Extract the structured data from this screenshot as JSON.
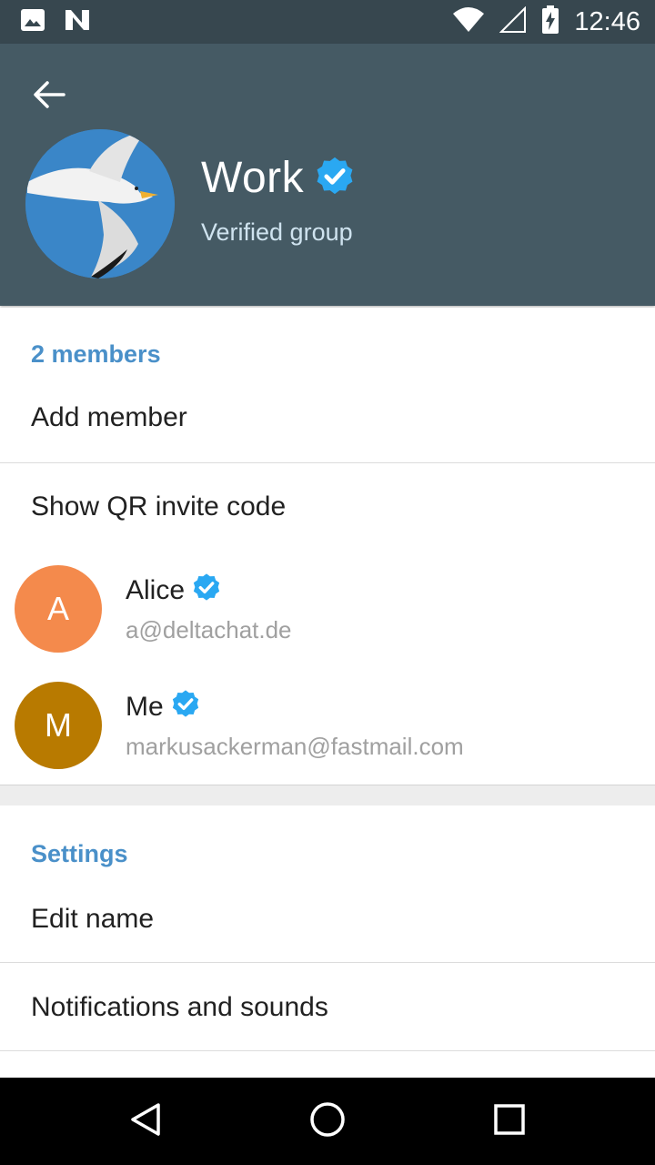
{
  "status_bar": {
    "time": "12:46",
    "icons": [
      "image-icon",
      "n-notification-icon",
      "wifi-icon",
      "cell-signal-icon",
      "battery-charging-icon"
    ]
  },
  "header": {
    "title": "Work",
    "subtitle": "Verified group",
    "colors": {
      "background": "#455a64",
      "status_bar": "#37474f",
      "verified": "#2aa8f2"
    }
  },
  "members_section": {
    "header": "2 members",
    "add_member": "Add member",
    "show_qr": "Show QR invite code",
    "members": [
      {
        "initial": "A",
        "name": "Alice",
        "email": "a@deltachat.de",
        "color": "#f48a4c",
        "verified": true
      },
      {
        "initial": "M",
        "name": "Me",
        "email": "markusackerman@fastmail.com",
        "color": "#b87a00",
        "verified": true
      }
    ]
  },
  "settings_section": {
    "header": "Settings",
    "edit_name": "Edit name",
    "notifications": "Notifications and sounds"
  },
  "navigation_bar": {
    "buttons": [
      "back-triangle-icon",
      "home-circle-icon",
      "recents-square-icon"
    ]
  }
}
